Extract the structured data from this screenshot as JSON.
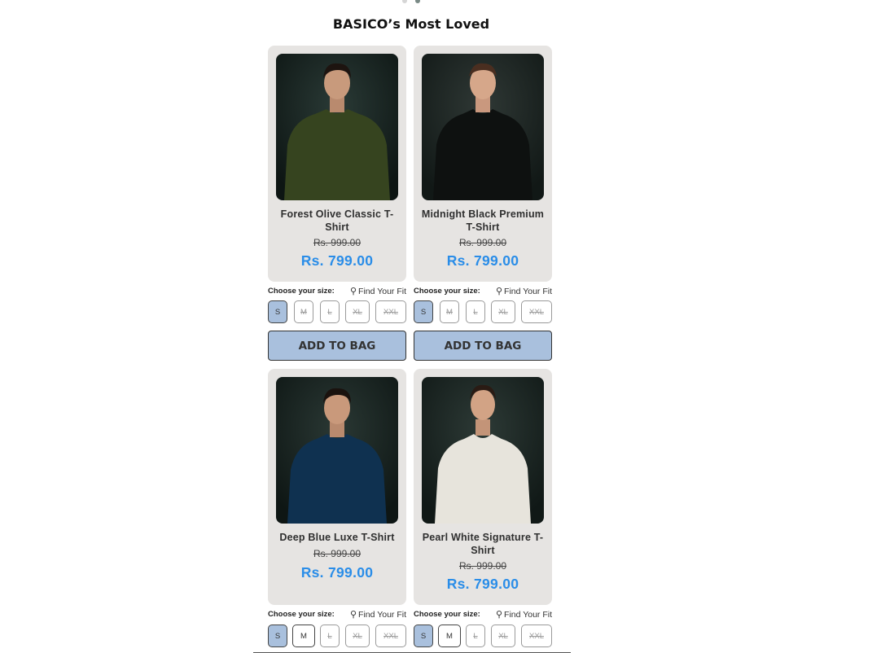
{
  "section": {
    "title": "BASICO’s Most Loved"
  },
  "common": {
    "size_label": "Choose your size:",
    "find_fit": "Find Your Fit",
    "add_to_bag": "ADD TO BAG",
    "sizes": [
      "S",
      "M",
      "L",
      "XL",
      "XXL"
    ]
  },
  "products": [
    {
      "name": "Forest Olive Classic T-Shirt",
      "old_price": "Rs. 999.00",
      "price": "Rs. 799.00",
      "shirt_color": "#36441f"
    },
    {
      "name": "Midnight Black Premium T-Shirt",
      "old_price": "Rs. 999.00",
      "price": "Rs. 799.00",
      "shirt_color": "#0e1110"
    },
    {
      "name": "Deep Blue Luxe T-Shirt",
      "old_price": "Rs. 999.00",
      "price": "Rs. 799.00",
      "shirt_color": "#0f3150"
    },
    {
      "name": "Pearl White Signature T-Shirt",
      "old_price": "Rs. 999.00",
      "price": "Rs. 799.00",
      "shirt_color": "#e7e4dc"
    }
  ],
  "colors": {
    "accent_price": "#2a8de8",
    "selected_size": "#a9c0dd",
    "card_bg": "#e6e4e2"
  }
}
